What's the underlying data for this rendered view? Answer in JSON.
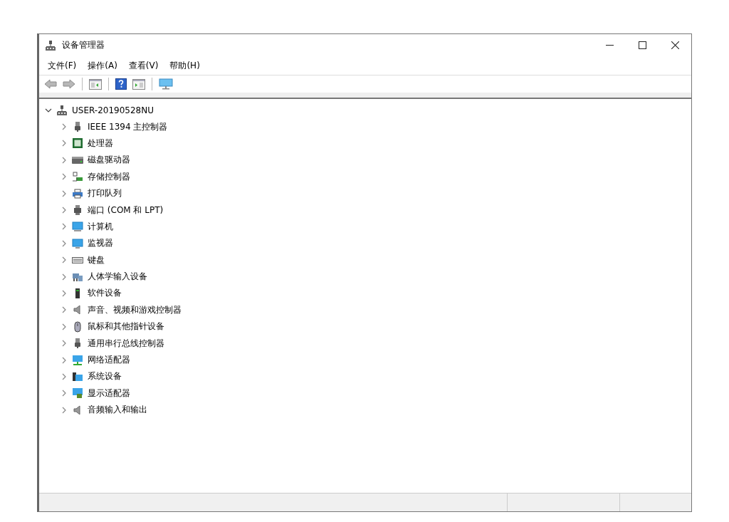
{
  "window": {
    "title": "设备管理器"
  },
  "menu": [
    {
      "label": "文件(F)"
    },
    {
      "label": "操作(A)"
    },
    {
      "label": "查看(V)"
    },
    {
      "label": "帮助(H)"
    }
  ],
  "tree": [
    {
      "label": "USER-20190528NU",
      "expanded": true,
      "children": [
        {
          "label": "IEEE 1394 主控制器",
          "expanded": false
        },
        {
          "label": "处理器",
          "expanded": false
        },
        {
          "label": "磁盘驱动器",
          "expanded": false
        },
        {
          "label": "存储控制器",
          "expanded": false
        },
        {
          "label": "打印队列",
          "expanded": false
        },
        {
          "label": "端口 (COM 和 LPT)",
          "expanded": false
        },
        {
          "label": "计算机",
          "expanded": false
        },
        {
          "label": "监视器",
          "expanded": false
        },
        {
          "label": "键盘",
          "expanded": false
        },
        {
          "label": "人体学输入设备",
          "expanded": false
        },
        {
          "label": "软件设备",
          "expanded": false
        },
        {
          "label": "声音、视频和游戏控制器",
          "expanded": false
        },
        {
          "label": "鼠标和其他指针设备",
          "expanded": false
        },
        {
          "label": "通用串行总线控制器",
          "expanded": false
        },
        {
          "label": "网络适配器",
          "expanded": false
        },
        {
          "label": "系统设备",
          "expanded": false
        },
        {
          "label": "显示适配器",
          "expanded": false
        },
        {
          "label": "音频输入和输出",
          "expanded": false
        }
      ]
    }
  ]
}
